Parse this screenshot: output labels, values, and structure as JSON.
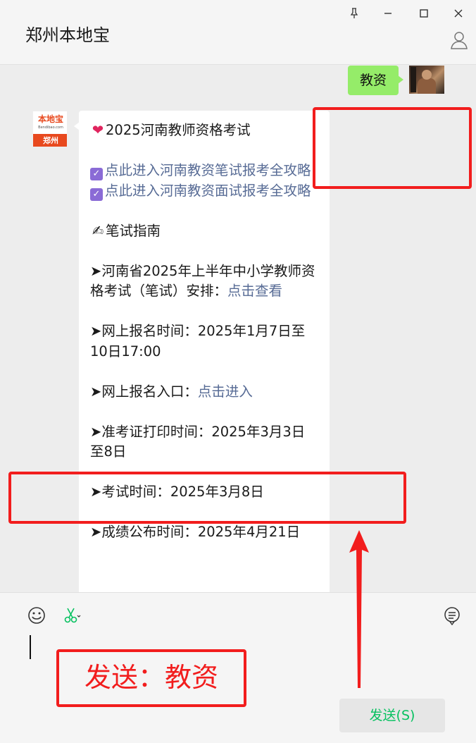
{
  "header": {
    "title": "郑州本地宝"
  },
  "my_message": {
    "text": "教资"
  },
  "bot": {
    "avatar": {
      "logo_text": "本地宝",
      "logo_sub": "Bendibao.com",
      "city": "郑州"
    },
    "lines": {
      "l1_text": "2025河南教师资格考试",
      "l2_link": "点此进入河南教资笔试报考全攻略",
      "l3_link": "点此进入河南教资面试报考全攻略",
      "l4_text": "笔试指南",
      "l5_text": "➤河南省2025年上半年中小学教师资格考试（笔试）安排：",
      "l5_link": "点击查看",
      "l6_text": "➤网上报名时间：2025年1月7日至10日17:00",
      "l7_text": "➤网上报名入口：",
      "l7_link": "点击进入",
      "l8_text": "➤准考证打印时间：2025年3月3日至8日",
      "l9_text": "➤考试时间：2025年3月8日",
      "l10_text": "➤成绩公布时间：2025年4月21日"
    }
  },
  "annotation": {
    "send_hint": "发送：教资"
  },
  "input": {
    "send_button": "发送(S)"
  },
  "icons": [
    "pin-icon",
    "minimize-icon",
    "maximize-icon",
    "close-icon",
    "profile-icon",
    "emoji-icon",
    "scissors-icon",
    "chat-history-icon"
  ],
  "colors": {
    "my_bubble": "#95ec69",
    "link": "#576b95",
    "annotation_red": "#f21d1d",
    "send_text": "#07c160"
  }
}
